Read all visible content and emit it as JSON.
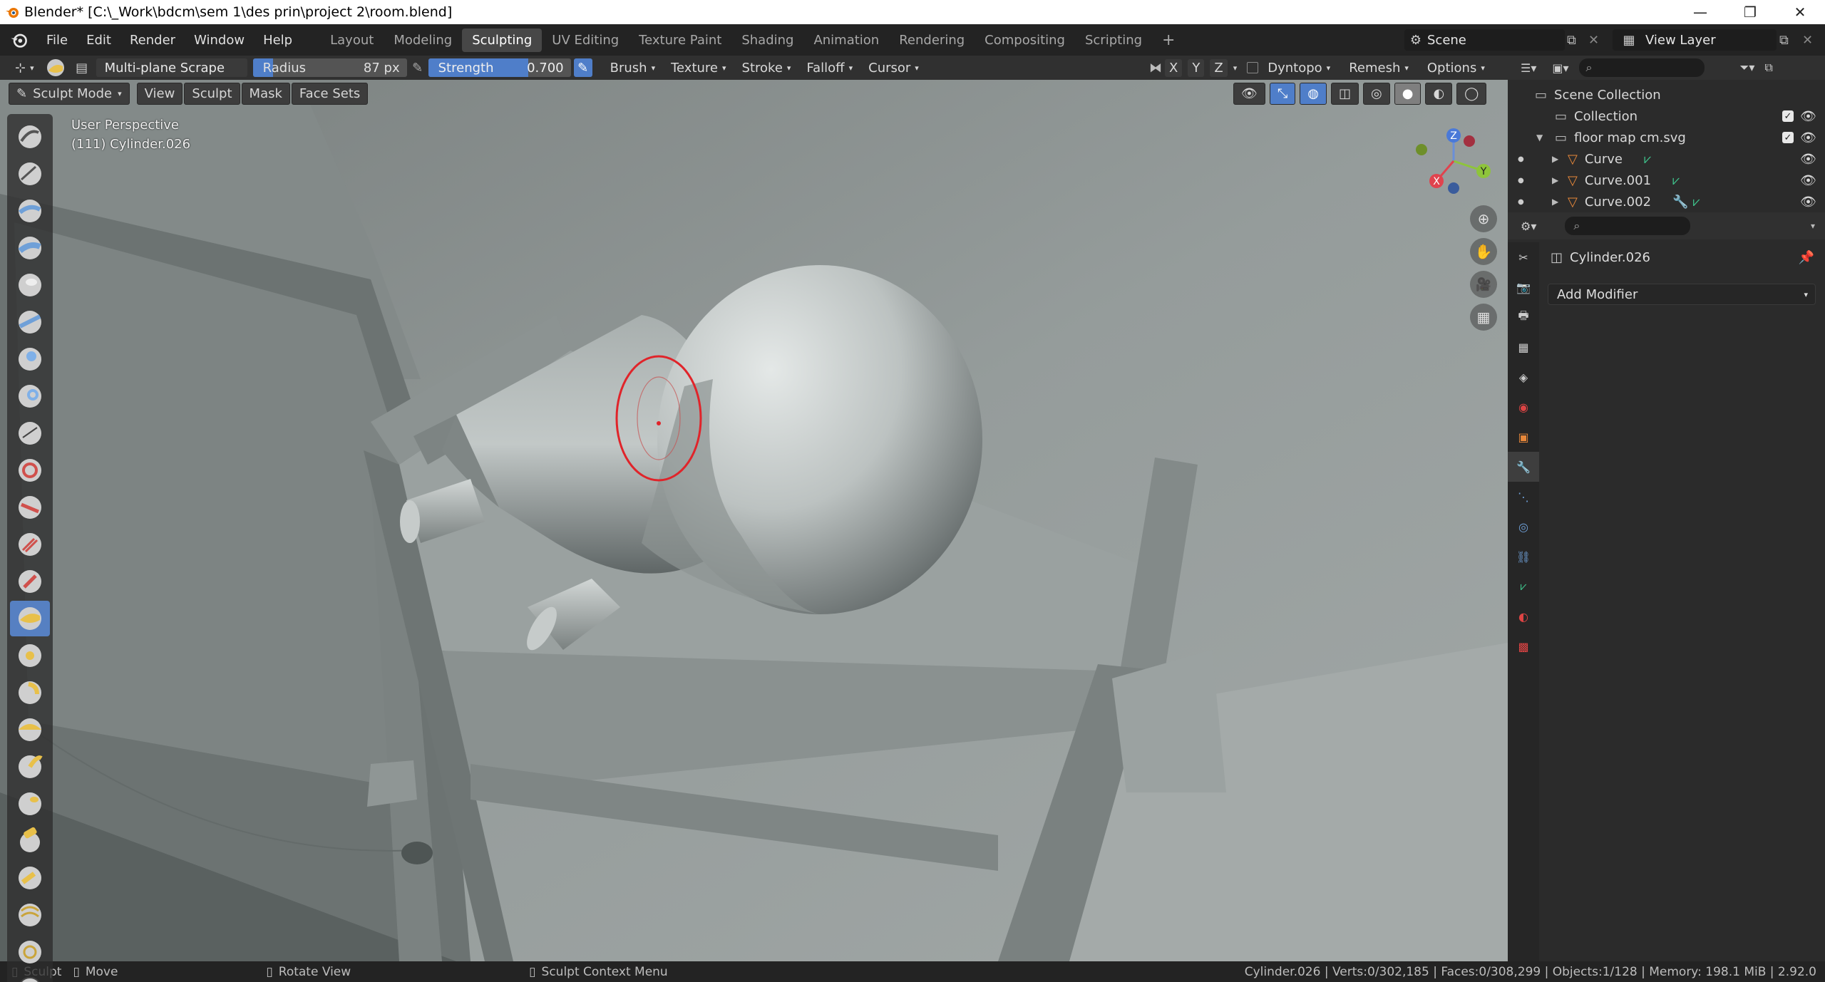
{
  "window": {
    "title": "Blender* [C:\\_Work\\bdcm\\sem 1\\des prin\\project 2\\room.blend]"
  },
  "menu": [
    "File",
    "Edit",
    "Render",
    "Window",
    "Help"
  ],
  "workspaces": [
    "Layout",
    "Modeling",
    "Sculpting",
    "UV Editing",
    "Texture Paint",
    "Shading",
    "Animation",
    "Rendering",
    "Compositing",
    "Scripting"
  ],
  "active_workspace": "Sculpting",
  "scene": {
    "label": "Scene",
    "view_layer": "View Layer"
  },
  "tool_header": {
    "brush_name": "Multi-plane Scrape",
    "radius_label": "Radius",
    "radius_value": "87 px",
    "strength_label": "Strength",
    "strength_value": "0.700",
    "menus": [
      "Brush",
      "Texture",
      "Stroke",
      "Falloff",
      "Cursor"
    ],
    "axes": [
      "X",
      "Y",
      "Z"
    ],
    "dyntopo": "Dyntopo",
    "remesh": "Remesh",
    "options": "Options"
  },
  "header2": {
    "mode": "Sculpt Mode",
    "buttons": [
      "View",
      "Sculpt",
      "Mask",
      "Face Sets"
    ]
  },
  "viewport": {
    "perspective": "User Perspective",
    "object": "(111) Cylinder.026",
    "gizmo_axes": [
      "Z",
      "Y",
      "X"
    ]
  },
  "outliner": {
    "root": "Scene Collection",
    "items": [
      {
        "label": "Collection"
      },
      {
        "label": "floor map cm.svg"
      },
      {
        "label": "Curve"
      },
      {
        "label": "Curve.001"
      },
      {
        "label": "Curve.002"
      }
    ]
  },
  "properties": {
    "object_name": "Cylinder.026",
    "add_modifier": "Add Modifier"
  },
  "statusbar": {
    "sculpt": "Sculpt",
    "move": "Move",
    "rotate": "Rotate View",
    "context": "Sculpt Context Menu",
    "stats": "Cylinder.026 | Verts:0/302,185 | Faces:0/308,299 | Objects:1/128 | Memory: 198.1 MiB | 2.92.0"
  },
  "colors": {
    "accent": "#5680c2",
    "brush_circle": "#e0242a",
    "object_orange": "#e8883a",
    "mesh_green": "#3ec08a"
  }
}
